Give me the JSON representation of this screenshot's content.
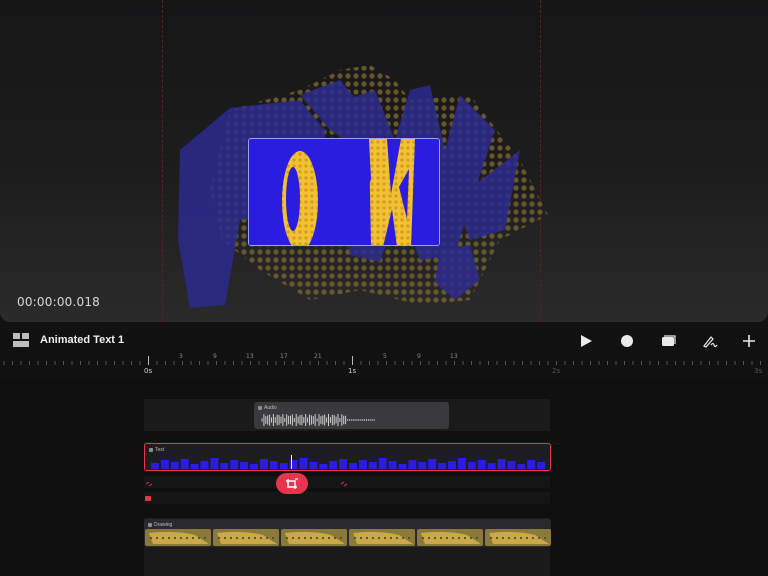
{
  "canvas": {
    "timecode": "00:00:00.018",
    "artwork_colors": {
      "navy": "#2b2a8e",
      "blue": "#2a1de0",
      "yellow": "#f1c232",
      "dots": "#6b5a2c"
    }
  },
  "toolbar": {
    "title": "Animated Text 1",
    "icons": [
      "layers-icon",
      "play-icon",
      "record-icon",
      "media-icon",
      "draw-icon",
      "add-icon"
    ]
  },
  "ruler": {
    "minor_labels": [
      "3",
      "9",
      "13",
      "17",
      "21",
      "5",
      "9",
      "13"
    ],
    "second_labels": [
      "0s",
      "1s",
      "2s",
      "3s"
    ]
  },
  "timeline": {
    "audio_clip": {
      "label": "Audio"
    },
    "text_clip": {
      "label": "Text"
    },
    "drawing_clip": {
      "label": "Drawing"
    },
    "accent": "#e8344d"
  }
}
